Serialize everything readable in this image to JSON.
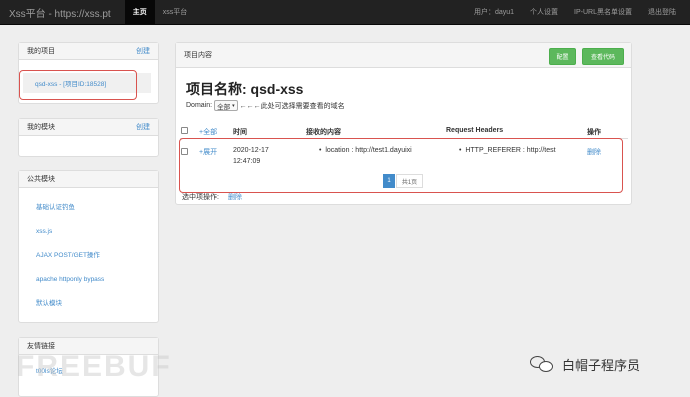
{
  "navbar": {
    "brand": "Xss平台 - https://xss.pt",
    "links": [
      "主页",
      "xss平台"
    ],
    "right_links": [
      "用户：dayu1",
      "个人设置",
      "IP-URL黑名单设置",
      "退出登陆"
    ]
  },
  "sidebar": {
    "my_projects": {
      "title": "我的项目",
      "action": "创建",
      "items": [
        "qsd-xss - [项目ID:18528]"
      ]
    },
    "my_modules": {
      "title": "我的模块",
      "action": "创建"
    },
    "public_modules": {
      "title": "公共模块",
      "items": [
        "基础认证钓鱼",
        "xss.js",
        "AJAX POST/GET操作",
        "apache httponly bypass",
        "默认模块"
      ]
    },
    "friend_links": {
      "title": "友情链接",
      "items": [
        "t00ls论坛"
      ]
    }
  },
  "main": {
    "panel_title": "项目内容",
    "config_button": "配置",
    "view_code_button": "查看代码",
    "project_title": "项目名称: qsd-xss",
    "domain_label": "Domain:",
    "domain_select": "全部",
    "domain_hint": "←←←此处可选择需要查看的域名",
    "table": {
      "headers": {
        "expand_all": "+全部",
        "time": "时间",
        "content": "接收的内容",
        "headers": "Request Headers",
        "action": "操作"
      },
      "rows": [
        {
          "expand": "+展开",
          "date": "2020-12-17",
          "time": "12:47:09",
          "content": "location : http://test1.dayuixi",
          "headers": "HTTP_REFERER : http://test",
          "action": "删除"
        }
      ]
    },
    "pagination": {
      "current": "1",
      "total": "共1页"
    },
    "bulk_action_label": "选中项操作:",
    "bulk_delete": "删除"
  },
  "watermark": "FREEBUF",
  "wechat_label": "白帽子程序员",
  "colors": {
    "navbar": "#222222",
    "link": "#428bca",
    "button": "#5cb85c",
    "highlight": "#d9534f"
  }
}
